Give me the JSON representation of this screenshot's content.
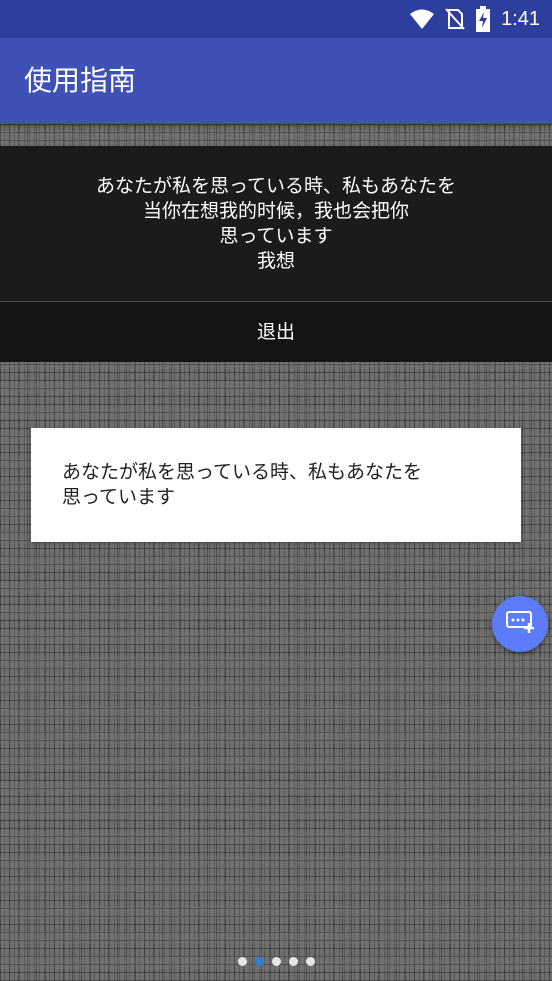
{
  "status_bar": {
    "time": "1:41",
    "icons": [
      "wifi-icon",
      "no-sim-icon",
      "battery-charging-icon"
    ]
  },
  "app_bar": {
    "title": "使用指南"
  },
  "dialog": {
    "message": "あなたが私を思っている時、私もあなたを\n当你在想我的时候，我也会把你\n思っています\n我想",
    "exit_label": "退出"
  },
  "card": {
    "text": "あなたが私を思っている時、私もあなたを\n思っています"
  },
  "fab": {
    "icon": "message-add-icon"
  },
  "pager": {
    "count": 5,
    "active_index": 1
  },
  "colors": {
    "status_bar": "#2d3e9c",
    "app_bar": "#3f51b5",
    "fab": "#5c7cfa",
    "active_dot": "#2f7fd1"
  }
}
